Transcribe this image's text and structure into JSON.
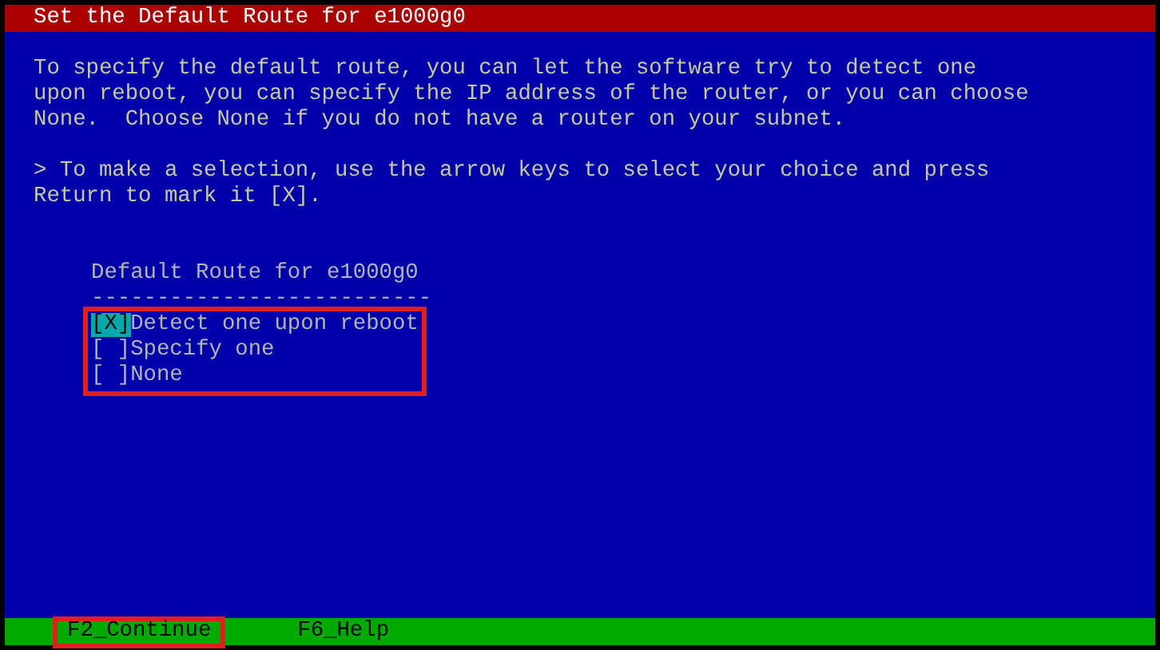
{
  "window": {
    "title": "Set the Default Route for e1000g0"
  },
  "instructions": [
    "To specify the default route, you can let the software try to detect one\nupon reboot, you can specify the IP address of the router, or you can choose\nNone.  Choose None if you do not have a router on your subnet.",
    "> To make a selection, use the arrow keys to select your choice and press\nReturn to mark it [X]."
  ],
  "choice_list": {
    "heading": "Default Route for e1000g0",
    "underline": "--------------------------",
    "highlighted": true,
    "options": [
      {
        "mark": "[X]",
        "label": "Detect one upon reboot",
        "selected": true
      },
      {
        "mark": "[ ]",
        "label": "Specify one",
        "selected": false
      },
      {
        "mark": "[ ]",
        "label": "None",
        "selected": false
      }
    ]
  },
  "function_keys": [
    {
      "label": "F2_Continue",
      "highlighted": true
    },
    {
      "label": "F6_Help",
      "highlighted": false
    }
  ]
}
